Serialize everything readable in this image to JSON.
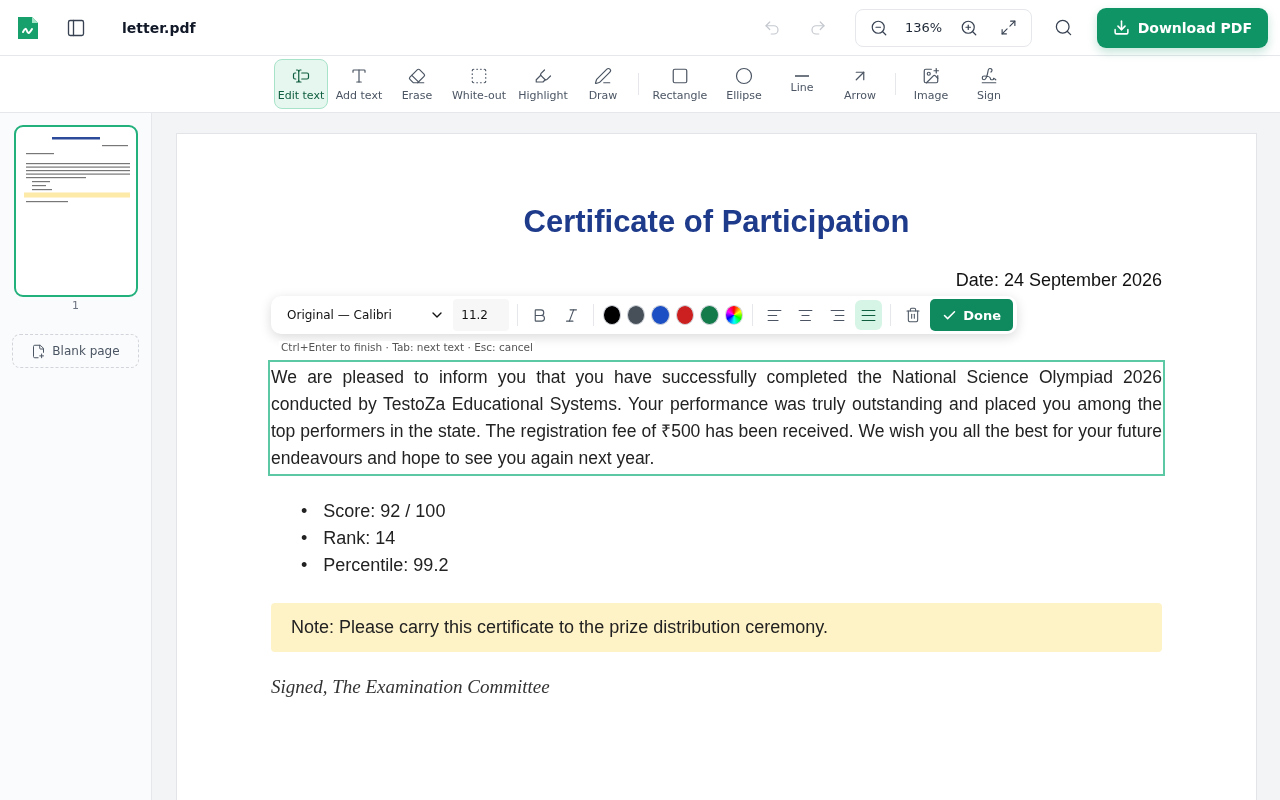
{
  "header": {
    "file_name": "letter.pdf",
    "zoom": "136%",
    "download_label": "Download PDF",
    "undo_disabled": true,
    "redo_disabled": true
  },
  "tools": [
    {
      "kind": "edit-text",
      "label": "Edit text",
      "selected": true
    },
    {
      "kind": "add-text",
      "label": "Add text",
      "selected": false
    },
    {
      "kind": "erase",
      "label": "Erase",
      "selected": false
    },
    {
      "kind": "white-out",
      "label": "White-out",
      "selected": false
    },
    {
      "kind": "highlight",
      "label": "Highlight",
      "selected": false
    },
    {
      "kind": "draw",
      "label": "Draw",
      "selected": false
    },
    {
      "kind": "rectangle",
      "label": "Rectangle",
      "selected": false
    },
    {
      "kind": "ellipse",
      "label": "Ellipse",
      "selected": false
    },
    {
      "kind": "line",
      "label": "Line",
      "selected": false
    },
    {
      "kind": "arrow",
      "label": "Arrow",
      "selected": false
    },
    {
      "kind": "image",
      "label": "Image",
      "selected": false
    },
    {
      "kind": "sign",
      "label": "Sign",
      "selected": false
    }
  ],
  "sidebar": {
    "pages": [
      {
        "number": "1",
        "selected": true
      }
    ],
    "blank_page_label": "Blank page"
  },
  "document": {
    "title": "Certificate of Participation",
    "date": "Date: 24 September 2026",
    "paragraph": "We are pleased to inform you that you have successfully completed the National Science Olympiad 2026 conducted by TestoZa Educational Systems. Your performance was truly outstanding and placed you among the top performers in the state. The registration fee of ₹500 has been received. We wish you all the best for your future endeavours and hope to see you again next year.",
    "bullet": "•",
    "bullets": [
      "Score: 92 / 100",
      "Rank: 14",
      "Percentile: 99.2"
    ],
    "note": "Note: Please carry this certificate to the prize distribution ceremony.",
    "signature": "Signed, The Examination Committee"
  },
  "text_toolbar": {
    "font": "Original — Calibri",
    "size": "11.2",
    "styles": [
      {
        "kind": "bold",
        "selected": false
      },
      {
        "kind": "italic",
        "selected": false
      }
    ],
    "colors": [
      {
        "kind": "swatch",
        "color": "#000000"
      },
      {
        "kind": "swatch",
        "color": "#475059"
      },
      {
        "kind": "swatch",
        "color": "#1d4fc4"
      },
      {
        "kind": "swatch",
        "color": "#cc1f1f"
      },
      {
        "kind": "swatch",
        "color": "#137a4a"
      },
      {
        "kind": "picker"
      }
    ],
    "alignments": [
      {
        "kind": "left",
        "selected": false
      },
      {
        "kind": "center",
        "selected": false
      },
      {
        "kind": "right",
        "selected": false
      },
      {
        "kind": "justify",
        "selected": true
      }
    ],
    "done_label": "Done",
    "hint": "Ctrl+Enter to finish · Tab: next text · Esc: cancel"
  }
}
